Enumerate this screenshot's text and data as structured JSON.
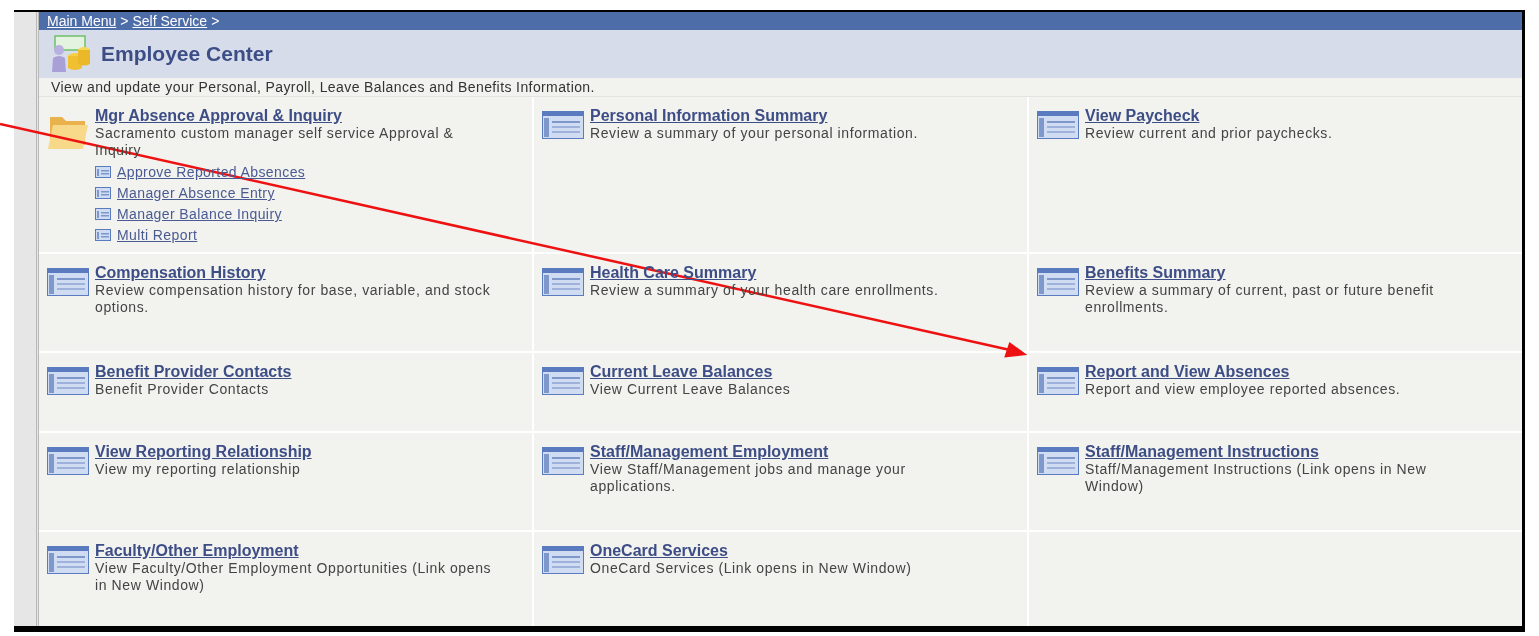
{
  "breadcrumb": [
    "Main Menu",
    "Self Service"
  ],
  "breadcrumb_separator": ">",
  "title": "Employee Center",
  "description": "View and update your Personal, Payroll, Leave Balances and Benefits Information.",
  "cells": [
    {
      "kind": "folder",
      "title": "Mgr Absence Approval & Inquiry",
      "text": "Sacramento custom manager self service Approval & Inquiry",
      "links": [
        "Approve Reported Absences",
        "Manager Absence Entry",
        "Manager Balance Inquiry",
        "Multi Report"
      ]
    },
    {
      "kind": "page",
      "title": "Personal Information Summary",
      "text": "Review a summary of your personal information."
    },
    {
      "kind": "page",
      "title": "View Paycheck",
      "text": "Review current and prior paychecks."
    },
    {
      "kind": "page",
      "title": "Compensation History",
      "text": "Review compensation history for base, variable, and stock options."
    },
    {
      "kind": "page",
      "title": "Health Care Summary",
      "text": "Review a summary of your health care enrollments."
    },
    {
      "kind": "page",
      "title": "Benefits Summary",
      "text": "Review a summary of current, past or future benefit enrollments."
    },
    {
      "kind": "page",
      "title": "Benefit Provider Contacts",
      "text": "Benefit Provider Contacts"
    },
    {
      "kind": "page",
      "title": "Current Leave Balances",
      "text": "View Current Leave Balances"
    },
    {
      "kind": "page",
      "title": "Report and View Absences",
      "text": "Report and view employee reported absences."
    },
    {
      "kind": "page",
      "title": "View Reporting Relationship",
      "text": "View my reporting relationship"
    },
    {
      "kind": "page",
      "title": "Staff/Management Employment",
      "text": "View Staff/Management jobs and manage your applications."
    },
    {
      "kind": "page",
      "title": "Staff/Management Instructions",
      "text": "Staff/Management Instructions (Link opens in New Window)"
    },
    {
      "kind": "page",
      "title": "Faculty/Other Employment",
      "text": "View Faculty/Other Employment Opportunities (Link opens in New Window)"
    },
    {
      "kind": "page",
      "title": "OneCard Services",
      "text": "OneCard Services (Link opens in New Window)"
    }
  ]
}
